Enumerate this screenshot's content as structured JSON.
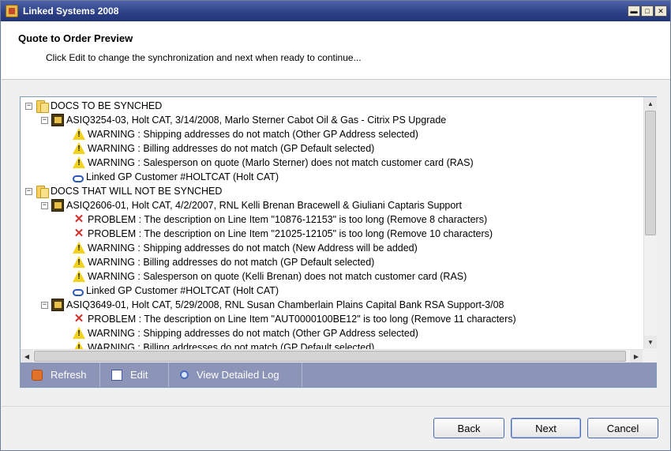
{
  "window": {
    "title": "Linked Systems 2008"
  },
  "header": {
    "title": "Quote to Order Preview",
    "subtitle": "Click Edit to change the synchronization and next when ready to continue..."
  },
  "tree": [
    {
      "level": 0,
      "icon": "folder",
      "expander": "−",
      "text": "DOCS TO BE SYNCHED"
    },
    {
      "level": 1,
      "icon": "document",
      "expander": "−",
      "text": "ASIQ3254-03, Holt CAT, 3/14/2008, Marlo Sterner Cabot Oil & Gas - Citrix PS Upgrade"
    },
    {
      "level": 2,
      "icon": "warning",
      "text": "WARNING : Shipping addresses do not match (Other GP Address selected)"
    },
    {
      "level": 2,
      "icon": "warning",
      "text": "WARNING : Billing addresses do not match (GP Default selected)"
    },
    {
      "level": 2,
      "icon": "warning",
      "text": "WARNING : Salesperson on quote (Marlo Sterner) does not match customer card (RAS)"
    },
    {
      "level": 2,
      "icon": "link",
      "text": "Linked GP Customer #HOLTCAT (Holt CAT)"
    },
    {
      "level": 0,
      "icon": "folder",
      "expander": "−",
      "text": "DOCS THAT WILL NOT BE SYNCHED"
    },
    {
      "level": 1,
      "icon": "document",
      "expander": "−",
      "text": "ASIQ2606-01, Holt CAT, 4/2/2007, RNL Kelli Brenan Bracewell & Giuliani Captaris Support"
    },
    {
      "level": 2,
      "icon": "problem",
      "text": "PROBLEM : The description on Line Item \"10876-12153\" is too long (Remove 8 characters)"
    },
    {
      "level": 2,
      "icon": "problem",
      "text": "PROBLEM : The description on Line Item \"21025-12105\" is too long (Remove 10 characters)"
    },
    {
      "level": 2,
      "icon": "warning",
      "text": "WARNING : Shipping addresses do not match (New Address will be added)"
    },
    {
      "level": 2,
      "icon": "warning",
      "text": "WARNING : Billing addresses do not match (GP Default selected)"
    },
    {
      "level": 2,
      "icon": "warning",
      "text": "WARNING : Salesperson on quote (Kelli Brenan) does not match customer card (RAS)"
    },
    {
      "level": 2,
      "icon": "link",
      "text": "Linked GP Customer #HOLTCAT (Holt CAT)"
    },
    {
      "level": 1,
      "icon": "document",
      "expander": "−",
      "text": "ASIQ3649-01, Holt CAT, 5/29/2008, RNL Susan Chamberlain Plains Capital Bank RSA Support-3/08"
    },
    {
      "level": 2,
      "icon": "problem",
      "text": "PROBLEM : The description on Line Item \"AUT0000100BE12\" is too long (Remove 11 characters)"
    },
    {
      "level": 2,
      "icon": "warning",
      "text": "WARNING : Shipping addresses do not match (Other GP Address selected)"
    },
    {
      "level": 2,
      "icon": "warning",
      "text": "WARNING : Billing addresses do not match (GP Default selected)"
    }
  ],
  "toolbar": {
    "refresh_label": "Refresh",
    "edit_label": "Edit",
    "log_label": "View Detailed Log"
  },
  "buttons": {
    "back": "Back",
    "next": "Next",
    "cancel": "Cancel"
  },
  "colors": {
    "titlebar": "#2c3f85",
    "toolbar": "#8c94b8",
    "warning": "#f2d21b",
    "problem": "#d0312d"
  }
}
